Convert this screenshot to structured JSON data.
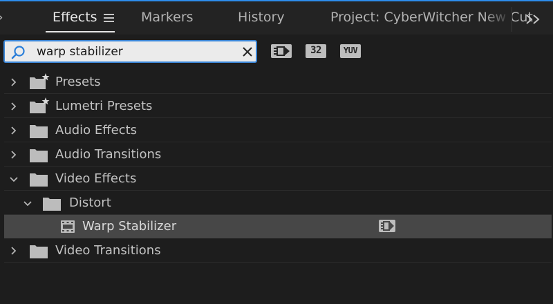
{
  "tabs": {
    "effects": "Effects",
    "markers": "Markers",
    "history": "History",
    "project": "Project: CyberWitcher New Cut"
  },
  "search": {
    "value": "warp stabilizer",
    "placeholder": ""
  },
  "filters": {
    "accelerated_icon": "accelerated-effects-icon",
    "bit32_label": "32",
    "yuv_label": "YUV"
  },
  "tree": {
    "items": [
      {
        "label": "Presets",
        "expanded": false,
        "icon": "preset-folder-icon"
      },
      {
        "label": "Lumetri Presets",
        "expanded": false,
        "icon": "preset-folder-icon"
      },
      {
        "label": "Audio Effects",
        "expanded": false,
        "icon": "folder-icon"
      },
      {
        "label": "Audio Transitions",
        "expanded": false,
        "icon": "folder-icon"
      },
      {
        "label": "Video Effects",
        "expanded": true,
        "icon": "folder-icon"
      },
      {
        "label": "Distort",
        "expanded": true,
        "icon": "folder-icon"
      },
      {
        "label": "Warp Stabilizer",
        "selected": true,
        "icon": "effect-icon"
      },
      {
        "label": "Video Transitions",
        "expanded": false,
        "icon": "folder-icon"
      }
    ]
  },
  "colors": {
    "accent": "#2d8ceb",
    "panel_bg": "#1d1d1d",
    "selected_row": "#474747"
  }
}
